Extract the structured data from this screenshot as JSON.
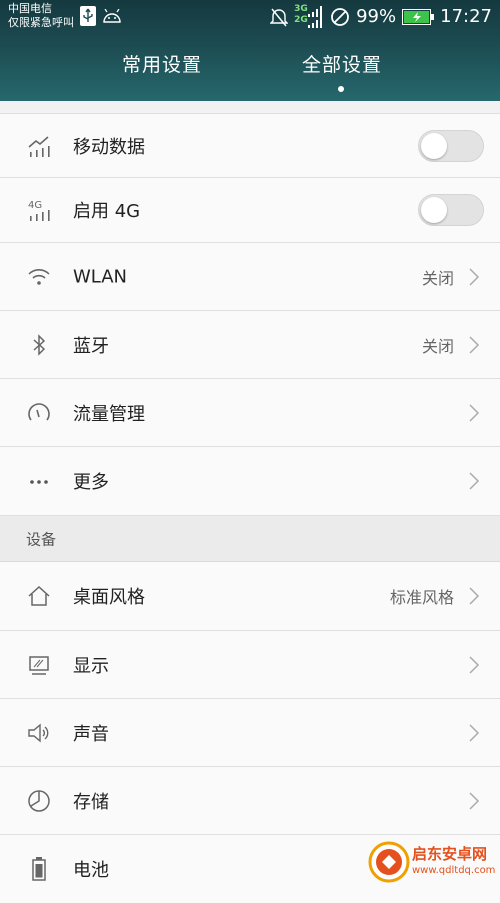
{
  "status_bar": {
    "carrier_line1": "中国电信",
    "carrier_line2": "仅限紧急呼叫",
    "network_3g": "3G",
    "network_2g": "2G",
    "battery_percent": "99%",
    "time": "17:27"
  },
  "tabs": [
    {
      "label": "常用设置",
      "active": false
    },
    {
      "label": "全部设置",
      "active": true
    }
  ],
  "rows_top": [
    {
      "icon": "mobile-data-icon",
      "label": "移动数据",
      "control": "toggle",
      "on": false
    },
    {
      "icon": "signal-4g-icon",
      "label": "启用 4G",
      "control": "toggle",
      "on": false
    },
    {
      "icon": "wifi-icon",
      "label": "WLAN",
      "value": "关闭",
      "control": "chevron"
    },
    {
      "icon": "bluetooth-icon",
      "label": "蓝牙",
      "value": "关闭",
      "control": "chevron"
    },
    {
      "icon": "data-usage-icon",
      "label": "流量管理",
      "control": "chevron"
    },
    {
      "icon": "more-icon",
      "label": "更多",
      "control": "chevron"
    }
  ],
  "section_device": {
    "label": "设备"
  },
  "rows_device": [
    {
      "icon": "home-icon",
      "label": "桌面风格",
      "value": "标准风格",
      "control": "chevron"
    },
    {
      "icon": "display-icon",
      "label": "显示",
      "control": "chevron"
    },
    {
      "icon": "sound-icon",
      "label": "声音",
      "control": "chevron"
    },
    {
      "icon": "storage-icon",
      "label": "存储",
      "control": "chevron"
    },
    {
      "icon": "battery-icon",
      "label": "电池",
      "control": "chevron"
    }
  ],
  "watermark": {
    "name": "启东安卓网",
    "url": "www.qdltdq.com"
  },
  "colors": {
    "header_dark": "#14393f",
    "header_light": "#26686d",
    "list_bg": "#fafafa",
    "section_bg": "#ebebeb",
    "battery_green": "#3ec34a",
    "watermark": "#e4511e"
  }
}
